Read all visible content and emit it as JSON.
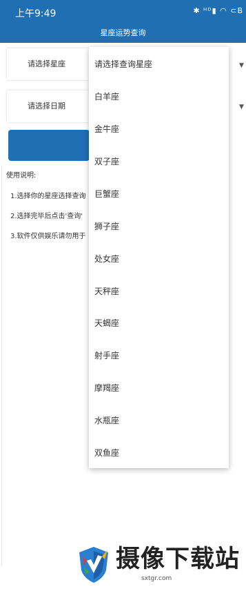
{
  "status_bar": {
    "time": "上午9:49",
    "icons": "✱ ᴴᴰ▮ ◠ ⊂B"
  },
  "app": {
    "title": "星座运势查询"
  },
  "form": {
    "zodiac_select": {
      "value": "请选择星座"
    },
    "date_select": {
      "value": "请选择日期"
    },
    "query_button": {
      "label": ""
    }
  },
  "usage": {
    "heading": "使用说明:",
    "items": [
      "1.选择你的星座选择查询",
      "2.选择完毕后点击'查询'",
      "3.软件仅供娱乐请勿用于"
    ]
  },
  "dropdown": {
    "options": [
      "请选择查询星座",
      "白羊座",
      "金牛座",
      "双子座",
      "巨蟹座",
      "狮子座",
      "处女座",
      "天秤座",
      "天蝎座",
      "射手座",
      "摩羯座",
      "水瓶座",
      "双鱼座"
    ]
  },
  "watermark": {
    "text": "摄像下载站",
    "url": "sxtgr.com"
  },
  "colors": {
    "accent": "#1f6fb2"
  }
}
